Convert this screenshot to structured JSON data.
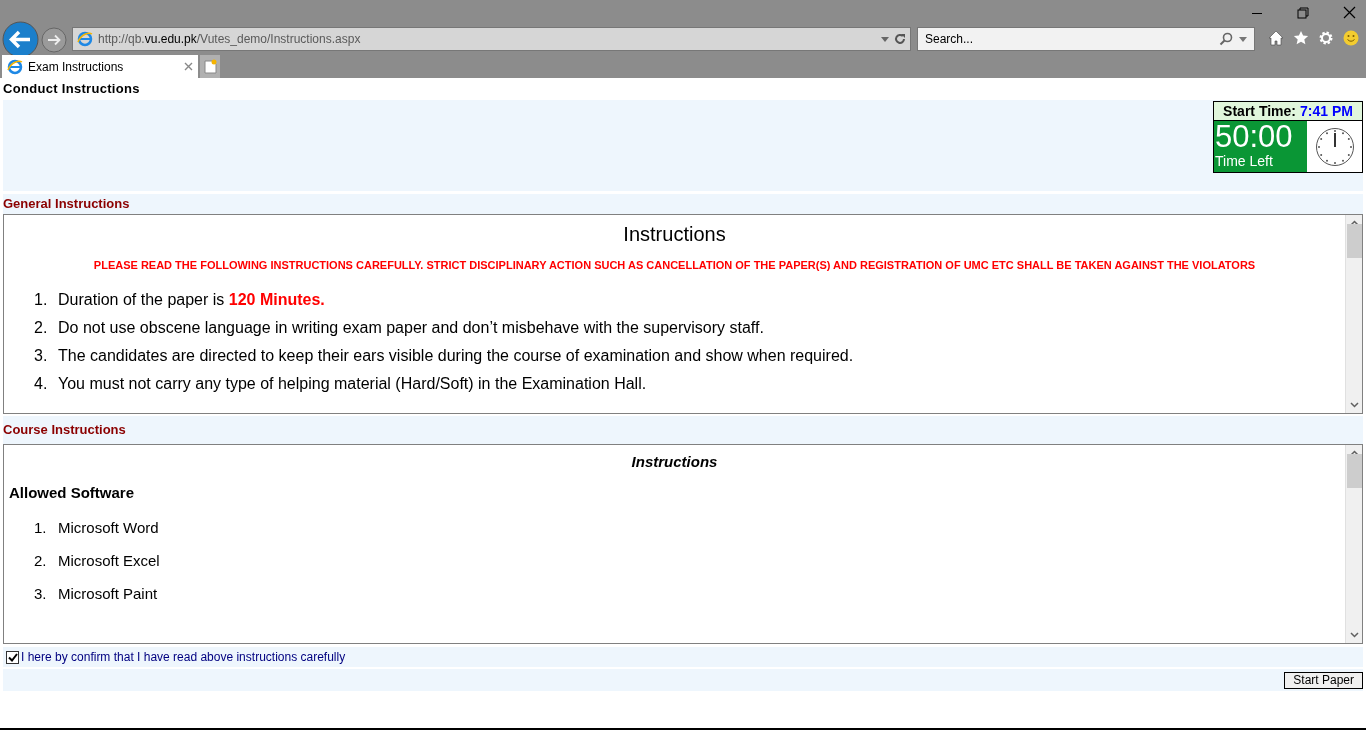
{
  "browser": {
    "url": "http://qb.**vu.edu.pk**/Vutes_demo/Instructions.aspx",
    "search": {
      "placeholder": "Search..."
    },
    "tabs": [
      {
        "label": "Exam Instructions",
        "selected": true
      }
    ]
  },
  "page": {
    "title": "Conduct Instructions",
    "timer": {
      "start_label": "Start Time:",
      "start_time": "7:41 PM",
      "remaining": "50:00",
      "remaining_label": "Time Left"
    },
    "general": {
      "heading": "General Instructions",
      "title": "Instructions",
      "warning": "PLEASE READ THE FOLLOWING INSTRUCTIONS CAREFULLY. STRICT DISCIPLINARY ACTION SUCH AS CANCELLATION OF THE PAPER(S) AND REGISTRATION OF UMC ETC SHALL BE TAKEN AGAINST THE VIOLATORS",
      "items": [
        {
          "number": "1.",
          "text": "Duration of the paper is **120 Minutes.**"
        },
        {
          "number": "2.",
          "text": "Do not use obscene language in writing exam paper and don’t misbehave with the supervisory staff."
        },
        {
          "number": "3.",
          "text": "The candidates are directed to keep their ears visible during the course of examination and show when required."
        },
        {
          "number": "4.",
          "text": "You must not carry any type of helping material (Hard/Soft) in the Examination Hall."
        }
      ]
    },
    "course": {
      "heading": "Course Instructions",
      "title": "Instructions",
      "subheading": "Allowed Software",
      "items": [
        {
          "number": "1.",
          "text": "Microsoft Word"
        },
        {
          "number": "2.",
          "text": "Microsoft Excel"
        },
        {
          "number": "3.",
          "text": "Microsoft Paint"
        }
      ]
    },
    "confirm": {
      "label": "I here by confirm that I have read above instructions carefully",
      "checked": true
    },
    "start_button": "Start Paper"
  }
}
